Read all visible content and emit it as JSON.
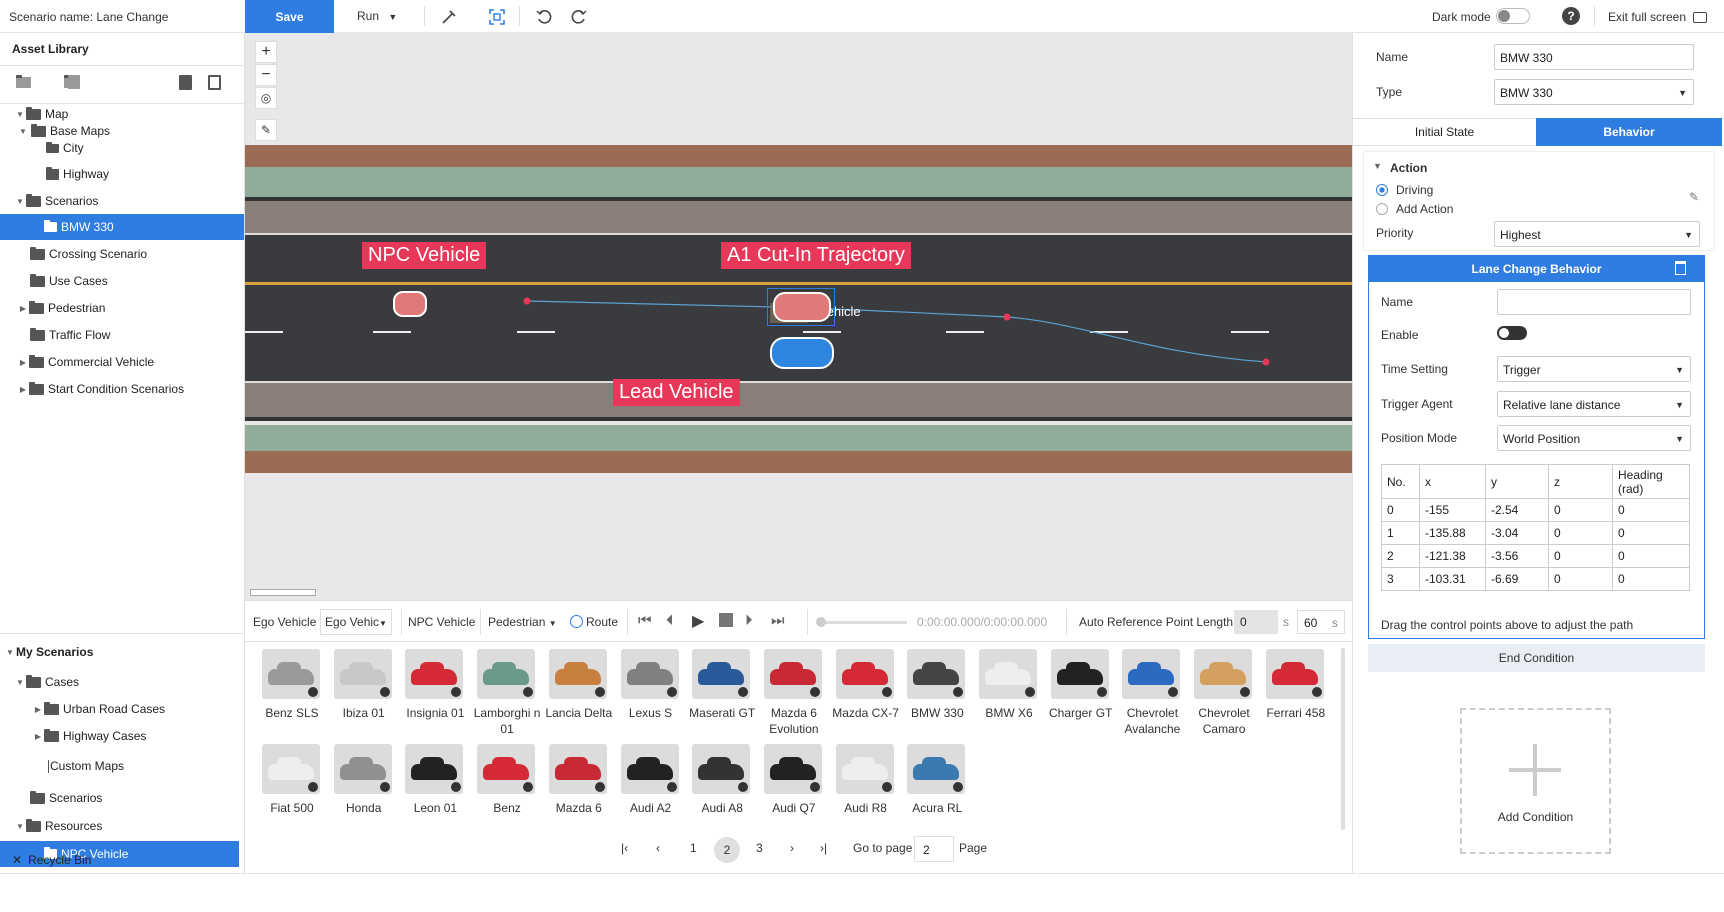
{
  "topbar": {
    "scenario_name": "Scenario name: Lane Change",
    "save": "Save",
    "run": "Run",
    "dark_mode": "Dark mode",
    "help": "?",
    "exit_full_screen": "Exit full screen"
  },
  "left": {
    "asset_library": "Asset Library",
    "my_scenarios": "My Scenarios",
    "recycle_bin": "Recycle Bin",
    "tree": [
      "Map",
      "Base Maps",
      "City",
      "Highway",
      "Scenarios",
      "BMW 330",
      "Crossing Scenario",
      "Use Cases",
      "Pedestrian",
      "Traffic Flow",
      "Commercial Vehicle",
      "Start Condition Scenarios"
    ],
    "my_tree": [
      "Cases",
      "Urban Road Cases",
      "Highway Cases",
      "Custom Maps",
      "Scenarios",
      "Resources",
      "NPC Vehicle"
    ]
  },
  "canvas": {
    "callouts": {
      "npc": "NPC Vehicle",
      "a1": "A1 Cut-In Trajectory",
      "lead": "Lead Vehicle"
    },
    "ego_label": "Ego Vehicle",
    "zoom_in": "+",
    "zoom_out": "−"
  },
  "controls": {
    "ego_vehicle": "Ego Vehicle",
    "ego_select": "Ego Vehicle",
    "npc_vehicle": "NPC Vehicle",
    "pedestrian": "Pedestrian",
    "route": "Route",
    "time": "0:00:00.000/0:00:00.000",
    "auto_ref": "Auto Reference Point Length",
    "ref_value": "0",
    "ref_unit": "s",
    "length_value": "60",
    "length_unit": "s"
  },
  "gallery": {
    "cars": [
      {
        "name": "Benz SLS",
        "color": "#9a9a9a"
      },
      {
        "name": "Ibiza 01",
        "color": "#c8c8c8"
      },
      {
        "name": "Insignia 01",
        "color": "#d42a35"
      },
      {
        "name": "Lamborghi n 01",
        "color": "#6a9a8a"
      },
      {
        "name": "Lancia Delta",
        "color": "#c88040"
      },
      {
        "name": "Lexus S",
        "color": "#808080"
      },
      {
        "name": "Maserati GT",
        "color": "#2a5a9a"
      },
      {
        "name": "Mazda 6 Evolution",
        "color": "#c82a35"
      },
      {
        "name": "Mazda CX-7",
        "color": "#d42a35"
      },
      {
        "name": "BMW 330",
        "color": "#444"
      },
      {
        "name": "BMW X6",
        "color": "#eee"
      },
      {
        "name": "Charger GT",
        "color": "#222"
      },
      {
        "name": "Chevrolet Avalanche",
        "color": "#2a6ac0"
      },
      {
        "name": "Chevrolet Camaro",
        "color": "#d4a060"
      },
      {
        "name": "Ferrari 458",
        "color": "#d42a35"
      },
      {
        "name": "Fiat 500",
        "color": "#eee"
      },
      {
        "name": "Honda",
        "color": "#909090"
      },
      {
        "name": "Leon 01",
        "color": "#222"
      },
      {
        "name": "Benz",
        "color": "#d42a35"
      },
      {
        "name": "Mazda 6",
        "color": "#c82a35"
      },
      {
        "name": "Audi A2",
        "color": "#222"
      },
      {
        "name": "Audi A8",
        "color": "#333"
      },
      {
        "name": "Audi Q7",
        "color": "#222"
      },
      {
        "name": "Audi R8",
        "color": "#eee"
      },
      {
        "name": "Acura RL",
        "color": "#3a7ab0"
      }
    ]
  },
  "pagination": {
    "pages": [
      "1",
      "2",
      "3"
    ],
    "current": "2",
    "go_to": "Go to page",
    "page_value": "2",
    "page": "Page"
  },
  "right": {
    "name_label": "Name",
    "name_value": "BMW 330",
    "type_label": "Type",
    "type_value": "BMW 330",
    "tab_initial": "Initial State",
    "tab_behavior": "Behavior",
    "action": "Action",
    "driving": "Driving",
    "add_action": "Add Action",
    "priority_label": "Priority",
    "priority_value": "Highest",
    "lcb": {
      "title": "Lane Change Behavior",
      "name": "Name",
      "enable": "Enable",
      "time_setting": "Time Setting",
      "time_value": "Trigger",
      "trigger_agent": "Trigger Agent",
      "trigger_value": "Relative lane distance",
      "position_mode": "Position Mode",
      "position_value": "World Position",
      "hint": "Drag the control points above to adjust the path"
    },
    "table": {
      "headers": [
        "No.",
        "x",
        "y",
        "z",
        "Heading (rad)"
      ],
      "rows": [
        [
          "0",
          "-155",
          "-2.54",
          "0",
          "0"
        ],
        [
          "1",
          "-135.88",
          "-3.04",
          "0",
          "0"
        ],
        [
          "2",
          "-121.38",
          "-3.56",
          "0",
          "0"
        ],
        [
          "3",
          "-103.31",
          "-6.69",
          "0",
          "0"
        ]
      ]
    },
    "end_condition": "End Condition",
    "add_condition": "Add Condition"
  }
}
